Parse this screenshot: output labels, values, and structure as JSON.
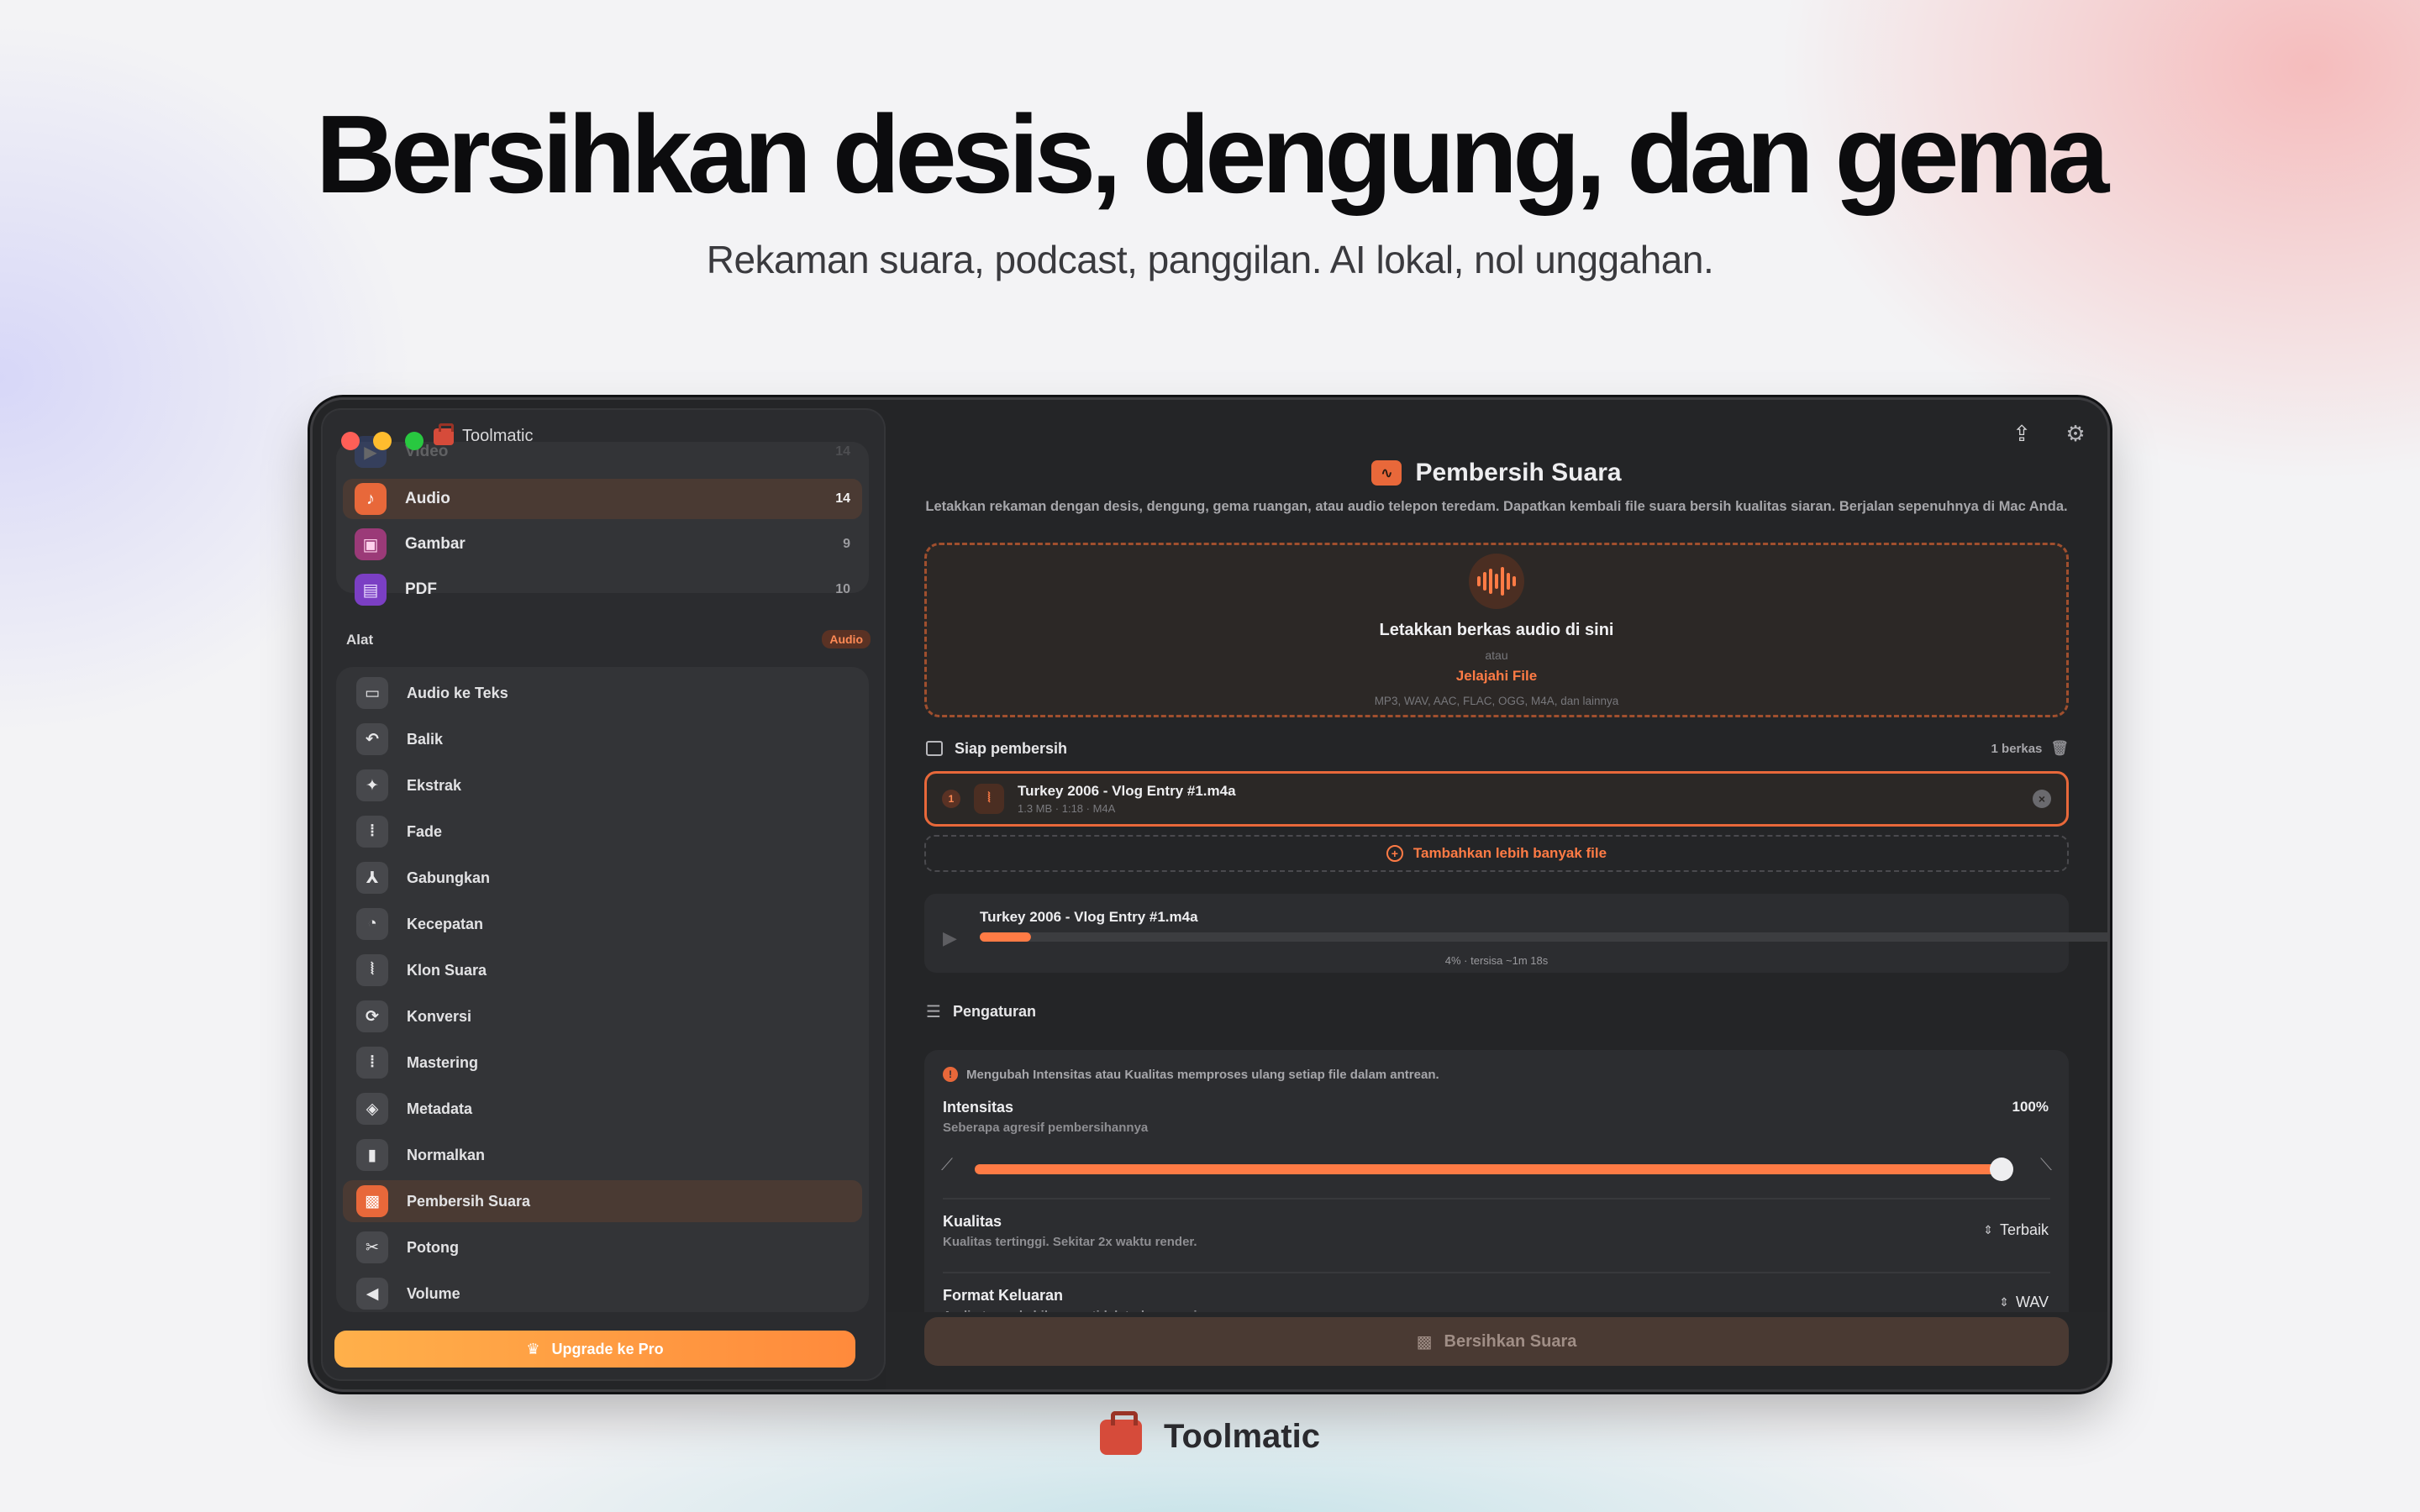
{
  "hero": {
    "headline": "Bersihkan desis, dengung, dan gema",
    "subline": "Rekaman suara, podcast, panggilan. AI lokal, nol unggahan."
  },
  "window": {
    "app_title": "Toolmatic"
  },
  "sidebar": {
    "categories": [
      {
        "label": "Video",
        "count": "14",
        "icon": "film-icon",
        "color": "#3d63c9"
      },
      {
        "label": "Audio",
        "count": "14",
        "icon": "music-note-icon",
        "color": "#e8683a"
      },
      {
        "label": "Gambar",
        "count": "9",
        "icon": "image-icon",
        "color": "#9b3a78"
      },
      {
        "label": "PDF",
        "count": "10",
        "icon": "document-icon",
        "color": "#7b3fc4"
      }
    ],
    "tools_label": "Alat",
    "tools_badge": "Audio",
    "tools": [
      {
        "label": "Audio ke Teks",
        "icon": "speech-bubble-icon"
      },
      {
        "label": "Balik",
        "icon": "undo-arrow-icon"
      },
      {
        "label": "Ekstrak",
        "icon": "extract-icon"
      },
      {
        "label": "Fade",
        "icon": "fade-wave-icon"
      },
      {
        "label": "Gabungkan",
        "icon": "merge-icon"
      },
      {
        "label": "Kecepatan",
        "icon": "speedometer-icon"
      },
      {
        "label": "Klon Suara",
        "icon": "voice-wave-icon"
      },
      {
        "label": "Konversi",
        "icon": "convert-arrows-icon"
      },
      {
        "label": "Mastering",
        "icon": "mastering-icon"
      },
      {
        "label": "Metadata",
        "icon": "tag-icon"
      },
      {
        "label": "Normalkan",
        "icon": "level-icon"
      },
      {
        "label": "Pembersih Suara",
        "icon": "waveform-box-icon"
      },
      {
        "label": "Potong",
        "icon": "scissors-icon"
      },
      {
        "label": "Volume",
        "icon": "speaker-icon"
      }
    ],
    "upgrade_label": "Upgrade ke Pro"
  },
  "main": {
    "title": "Pembersih Suara",
    "description": "Letakkan rekaman dengan desis, dengung, gema ruangan, atau audio telepon teredam. Dapatkan kembali file suara bersih kualitas siaran. Berjalan sepenuhnya di Mac Anda.",
    "dropzone": {
      "title": "Letakkan berkas audio di sini",
      "or": "atau",
      "browse": "Jelajahi File",
      "formats": "MP3, WAV, AAC, FLAC, OGG, M4A, dan lainnya"
    },
    "queue": {
      "title": "Siap pembersih",
      "count": "1 berkas",
      "files": [
        {
          "index": "1",
          "name": "Turkey 2006 - Vlog Entry #1.m4a",
          "meta": "1.3 MB · 1:18 · M4A"
        }
      ],
      "add_more": "Tambahkan lebih banyak file"
    },
    "progress": {
      "file_name": "Turkey 2006 - Vlog Entry #1.m4a",
      "percent": 4,
      "status": "4% · tersisa ~1m 18s"
    },
    "settings": {
      "title": "Pengaturan",
      "notice": "Mengubah Intensitas atau Kualitas memproses ulang setiap file dalam antrean.",
      "intensity_label": "Intensitas",
      "intensity_sub": "Seberapa agresif pembersihannya",
      "intensity_value": "100%",
      "intensity_level": 1.0,
      "quality_label": "Kualitas",
      "quality_sub": "Kualitas tertinggi. Sekitar 2x waktu render.",
      "quality_value": "Terbaik",
      "format_label": "Format Keluaran",
      "format_sub": "Audio tanpa kehilangan, tidak terkompresi",
      "format_value": "WAV"
    },
    "action_button": "Bersihkan Suara"
  },
  "brand": {
    "name": "Toolmatic"
  },
  "colors": {
    "accent": "#e8683a",
    "accent_light": "#ff7b45",
    "window_bg": "#242527",
    "sidebar_bg": "#2b2c2f"
  }
}
